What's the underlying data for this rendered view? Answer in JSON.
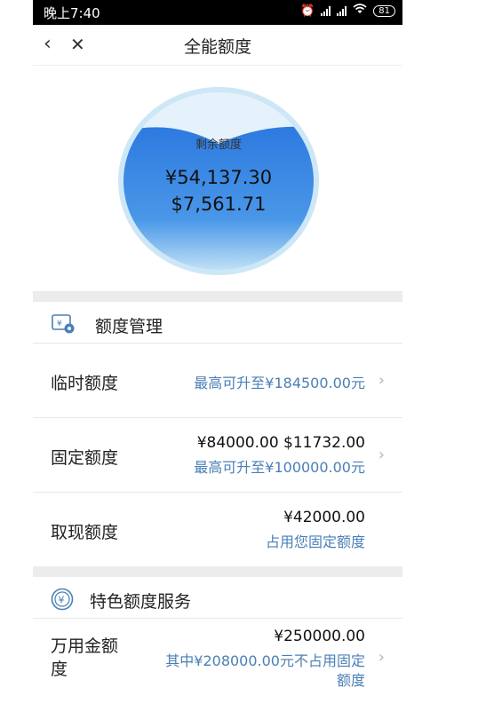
{
  "status_bar": {
    "time": "晚上7:40",
    "battery": "81",
    "icons": [
      "alarm-icon",
      "signal-icon",
      "signal-icon",
      "wifi-icon",
      "battery-icon"
    ]
  },
  "nav": {
    "title": "全能额度",
    "back_icon": "chevron-left-icon",
    "close_icon": "close-icon"
  },
  "gauge": {
    "label": "剩余额度",
    "amount_cny": "¥54,137.30",
    "amount_usd": "$7,561.71",
    "colors": {
      "water": "#2f7fe0",
      "ring": "#cde7f7"
    }
  },
  "quota_management": {
    "title": "额度管理",
    "icon": "quota-card-icon",
    "rows": [
      {
        "name": "临时额度",
        "value": "",
        "sub": "最高可升至¥184500.00元"
      },
      {
        "name": "固定额度",
        "value": "¥84000.00 $11732.00",
        "sub": "最高可升至¥100000.00元"
      },
      {
        "name": "取现额度",
        "value": "¥42000.00",
        "sub": "占用您固定额度"
      }
    ]
  },
  "special_services": {
    "title": "特色额度服务",
    "icon": "yen-coin-icon",
    "rows": [
      {
        "name_line1": "万用金额",
        "name_line2": "度",
        "value": "¥250000.00",
        "sub_line1": "其中¥208000.00元不占用固定",
        "sub_line2": "额度"
      }
    ]
  },
  "accent_color": "#4a7fb6"
}
